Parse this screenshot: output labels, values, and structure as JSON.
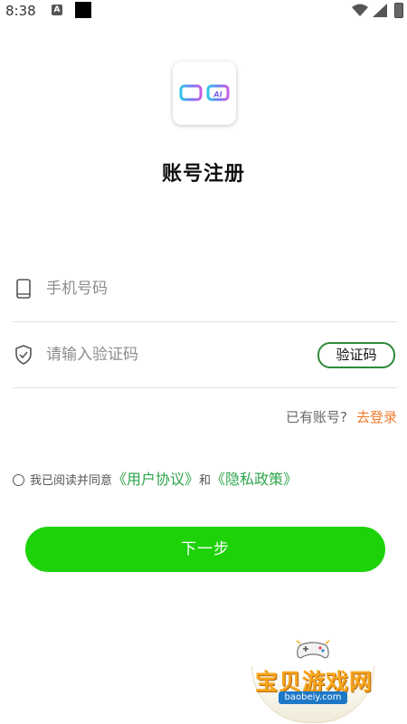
{
  "status_bar": {
    "time": "8:38",
    "notification_glyph": "A"
  },
  "register": {
    "title": "账号注册",
    "phone": {
      "placeholder": "手机号码",
      "value": ""
    },
    "code": {
      "placeholder": "请输入验证码",
      "value": "",
      "button_label": "验证码"
    },
    "login_hint": "已有账号?",
    "login_link": "去登录",
    "agreement": {
      "prefix": "我已阅读并同意",
      "terms_link": "《用户协议》",
      "and": "和",
      "privacy_link": "《隐私政策》",
      "checked": false
    },
    "next_button": "下一步"
  },
  "watermark": {
    "title": "宝贝游戏网",
    "url": "baobeiy.com"
  },
  "colors": {
    "primary_green": "#1ed20a",
    "link_green": "#2ea54a",
    "accent_orange": "#ef7b2d",
    "outline_green": "#2e8a3a"
  },
  "icons": [
    "wifi-icon",
    "signal-icon",
    "battery-icon",
    "glasses-logo-icon",
    "phone-icon",
    "shield-check-icon",
    "radio-unchecked-icon",
    "gamepad-icon"
  ]
}
